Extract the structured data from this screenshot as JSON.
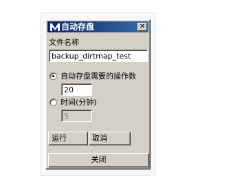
{
  "window": {
    "title": "自动存盘",
    "close_glyph": "✕"
  },
  "form": {
    "file_name_label": "文件名称",
    "file_name_value": "backup_dirtmap_test",
    "ops_option_label": "自动存盘需要的操作数",
    "ops_value": "20",
    "time_option_label": "时间(分钟)",
    "time_value": "5",
    "selected_option": "ops"
  },
  "buttons": {
    "run": "运行",
    "cancel": "取消",
    "close": "关闭"
  },
  "colors": {
    "title_gradient_start": "#0a246a",
    "title_gradient_end": "#3a6ea5",
    "face": "#d4d0c8"
  },
  "icons": {
    "app": "maya-logo-icon",
    "close": "close-x-icon"
  }
}
